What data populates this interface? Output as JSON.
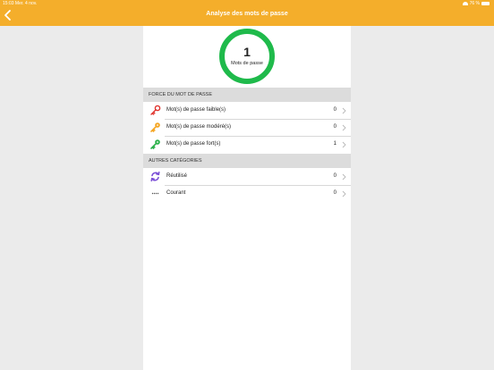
{
  "status_bar": {
    "time": "15:03",
    "date": "Mer. 4 nov.",
    "battery": "76 %"
  },
  "header": {
    "title": "Analyse des mots de passe",
    "back_icon": "chevron-left-icon"
  },
  "summary": {
    "count": "1",
    "label": "Mots de passe"
  },
  "strength_section": {
    "title": "FORCE DU MOT DE PASSE",
    "items": [
      {
        "label": "Mot(s) de passe faible(s)",
        "count": "0",
        "icon": "key-icon-red",
        "color": "#e0332d"
      },
      {
        "label": "Mot(s) de passe modéré(s)",
        "count": "0",
        "icon": "key-icon-orange",
        "color": "#f5a623"
      },
      {
        "label": "Mot(s) de passe fort(s)",
        "count": "1",
        "icon": "key-icon-green",
        "color": "#2bb14a"
      }
    ]
  },
  "other_section": {
    "title": "AUTRES CATÉGORIES",
    "items": [
      {
        "label": "Réutilisé",
        "count": "0",
        "icon": "reuse-icon",
        "color": "#7b4fd6"
      },
      {
        "label": "Courant",
        "count": "0",
        "icon": "dots-icon",
        "color": "#555555"
      }
    ]
  },
  "colors": {
    "accent": "#f4ae2b",
    "ring": "#1fba4b",
    "background": "#ebebeb"
  }
}
